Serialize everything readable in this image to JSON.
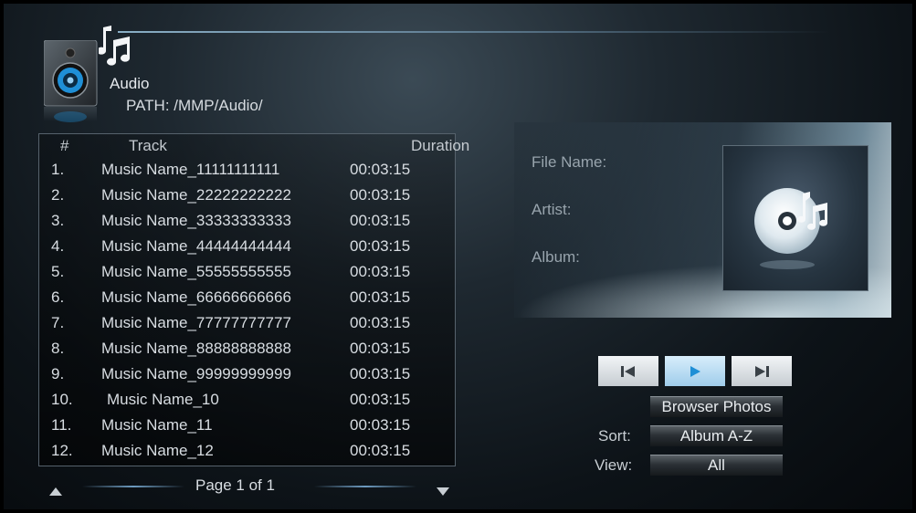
{
  "header": {
    "title": "Audio",
    "path": "PATH: /MMP/Audio/"
  },
  "track_list": {
    "columns": {
      "number": "#",
      "track": "Track",
      "duration": "Duration"
    },
    "rows": [
      {
        "number": "1.",
        "name": "Music Name_11111111111",
        "duration": "00:03:15"
      },
      {
        "number": "2.",
        "name": "Music Name_22222222222",
        "duration": "00:03:15"
      },
      {
        "number": "3.",
        "name": "Music Name_33333333333",
        "duration": "00:03:15"
      },
      {
        "number": "4.",
        "name": "Music Name_44444444444",
        "duration": "00:03:15"
      },
      {
        "number": "5.",
        "name": "Music Name_55555555555",
        "duration": "00:03:15"
      },
      {
        "number": "6.",
        "name": "Music Name_66666666666",
        "duration": "00:03:15"
      },
      {
        "number": "7.",
        "name": "Music Name_77777777777",
        "duration": "00:03:15"
      },
      {
        "number": "8.",
        "name": "Music Name_88888888888",
        "duration": "00:03:15"
      },
      {
        "number": "9.",
        "name": "Music Name_99999999999",
        "duration": "00:03:15"
      },
      {
        "number": "10.",
        "name": "Music Name_10",
        "duration": "00:03:15"
      },
      {
        "number": "11.",
        "name": "Music Name_11",
        "duration": "00:03:15"
      },
      {
        "number": "12.",
        "name": "Music Name_12",
        "duration": "00:03:15"
      }
    ],
    "pagination": "Page 1 of 1"
  },
  "info": {
    "file_name_label": "File Name:",
    "artist_label": "Artist:",
    "album_label": "Album:"
  },
  "controls": {
    "previous_icon": "skip-previous-icon",
    "play_icon": "play-icon",
    "next_icon": "skip-next-icon",
    "browser_photos_label": "Browser Photos",
    "sort_label": "Sort:",
    "sort_value": "Album A-Z",
    "view_label": "View:",
    "view_value": "All"
  },
  "colors": {
    "accent_blue": "#1e8fd6",
    "panel_border": "#56626c",
    "text": "#d8dde2"
  }
}
